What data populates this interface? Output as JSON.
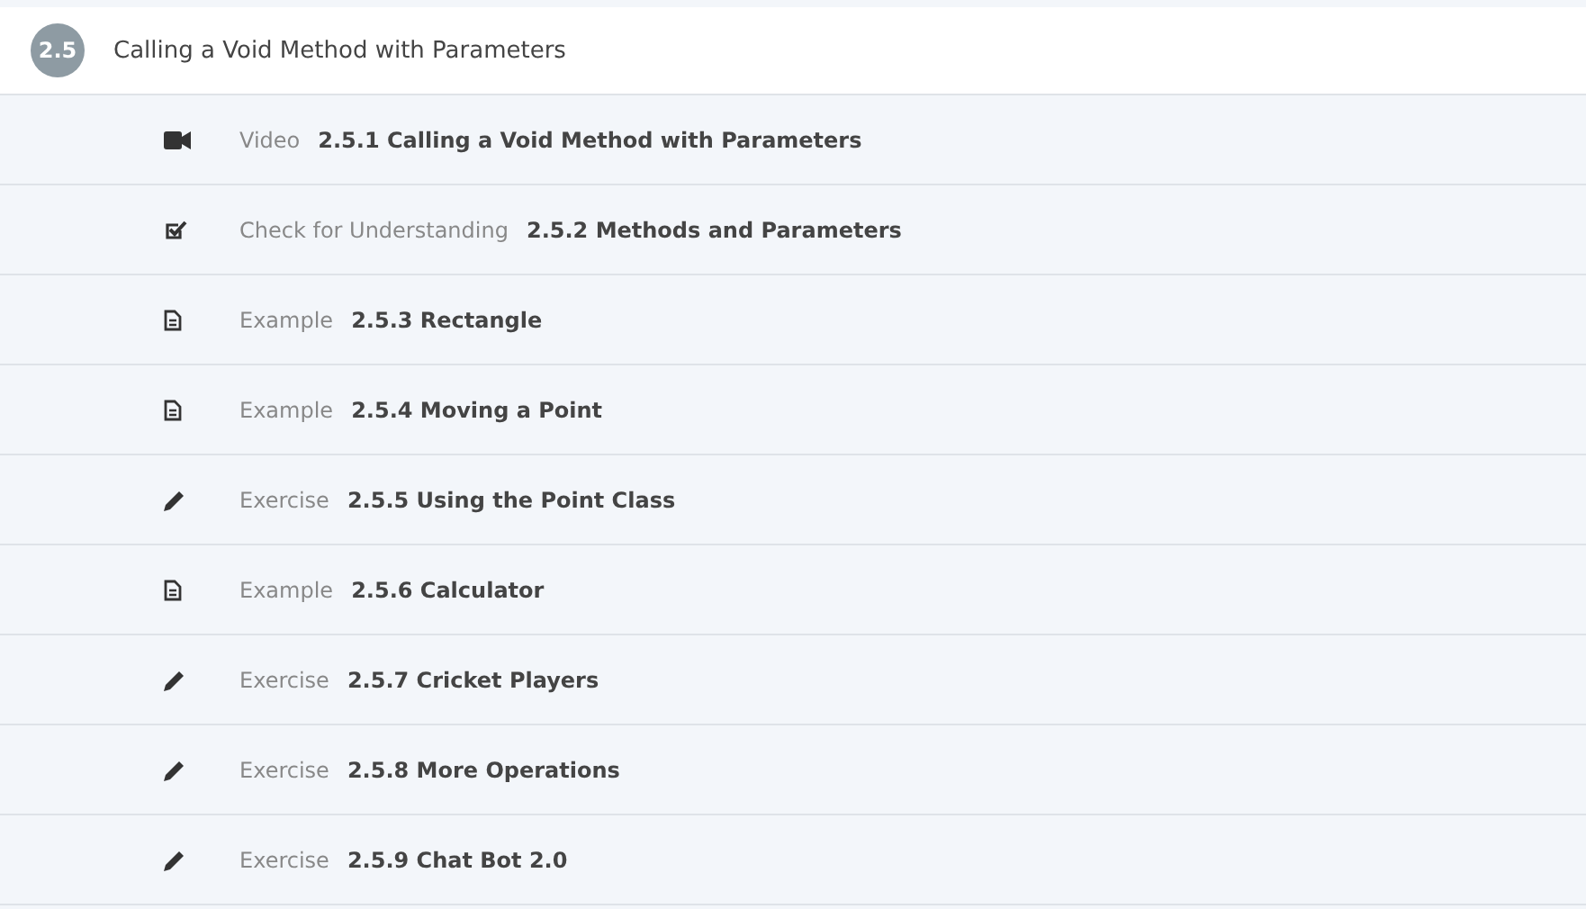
{
  "section": {
    "number": "2.5",
    "title": "Calling a Void Method with Parameters"
  },
  "items": [
    {
      "kind": "video",
      "type": "Video",
      "title": "2.5.1 Calling a Void Method with Parameters"
    },
    {
      "kind": "quiz",
      "type": "Check for Understanding",
      "title": "2.5.2 Methods and Parameters"
    },
    {
      "kind": "example",
      "type": "Example",
      "title": "2.5.3 Rectangle"
    },
    {
      "kind": "example",
      "type": "Example",
      "title": "2.5.4 Moving a Point"
    },
    {
      "kind": "exercise",
      "type": "Exercise",
      "title": "2.5.5 Using the Point Class"
    },
    {
      "kind": "example",
      "type": "Example",
      "title": "2.5.6 Calculator"
    },
    {
      "kind": "exercise",
      "type": "Exercise",
      "title": "2.5.7 Cricket Players"
    },
    {
      "kind": "exercise",
      "type": "Exercise",
      "title": "2.5.8 More Operations"
    },
    {
      "kind": "exercise",
      "type": "Exercise",
      "title": "2.5.9 Chat Bot 2.0"
    }
  ]
}
